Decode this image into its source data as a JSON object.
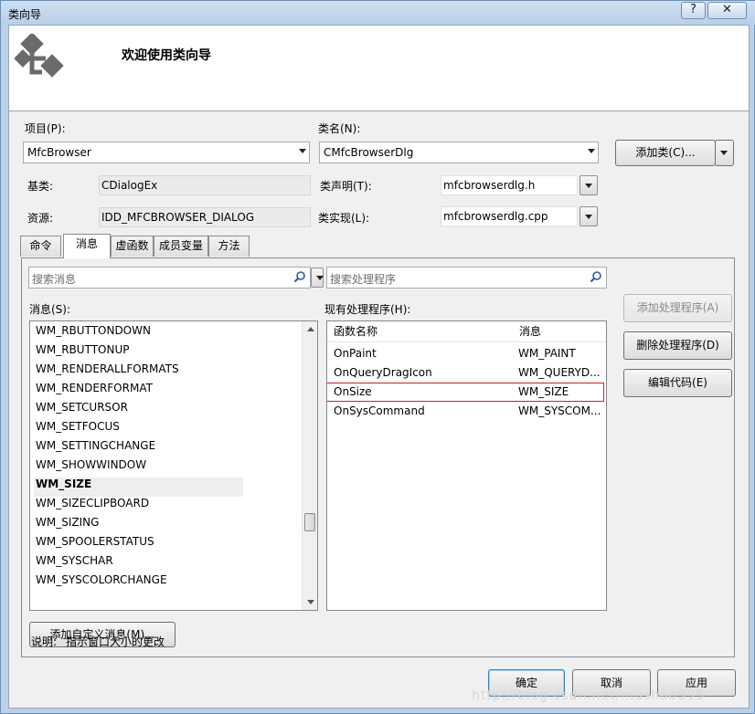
{
  "window": {
    "title": "类向导",
    "help_label": "?",
    "close_label": "✕"
  },
  "header": {
    "title": "欢迎使用类向导"
  },
  "form": {
    "project_label": "项目(P):",
    "project_value": "MfcBrowser",
    "classname_label": "类名(N):",
    "classname_value": "CMfcBrowserDlg",
    "add_class_label": "添加类(C)...",
    "base_label": "基类:",
    "base_value": "CDialogEx",
    "decl_label": "类声明(T):",
    "decl_value": "mfcbrowserdlg.h",
    "resource_label": "资源:",
    "resource_value": "IDD_MFCBROWSER_DIALOG",
    "impl_label": "类实现(L):",
    "impl_value": "mfcbrowserdlg.cpp"
  },
  "tabs": [
    "命令",
    "消息",
    "虚函数",
    "成员变量",
    "方法"
  ],
  "messages": {
    "search_placeholder": "搜索消息",
    "label": "消息(S):",
    "items": [
      "WM_RBUTTONDOWN",
      "WM_RBUTTONUP",
      "WM_RENDERALLFORMATS",
      "WM_RENDERFORMAT",
      "WM_SETCURSOR",
      "WM_SETFOCUS",
      "WM_SETTINGCHANGE",
      "WM_SHOWWINDOW",
      "WM_SIZE",
      "WM_SIZECLIPBOARD",
      "WM_SIZING",
      "WM_SPOOLERSTATUS",
      "WM_SYSCHAR",
      "WM_SYSCOLORCHANGE"
    ],
    "selected": "WM_SIZE",
    "add_custom_label": "添加自定义消息(M)..."
  },
  "handlers": {
    "search_placeholder": "搜索处理程序",
    "label": "现有处理程序(H):",
    "col_func": "函数名称",
    "col_msg": "消息",
    "rows": [
      {
        "func": "OnPaint",
        "msg": "WM_PAINT"
      },
      {
        "func": "OnQueryDragIcon",
        "msg": "WM_QUERYD..."
      },
      {
        "func": "OnSize",
        "msg": "WM_SIZE"
      },
      {
        "func": "OnSysCommand",
        "msg": "WM_SYSCOM..."
      }
    ]
  },
  "actions": {
    "add_handler": "添加处理程序(A)",
    "delete_handler": "删除处理程序(D)",
    "edit_code": "编辑代码(E)"
  },
  "description": {
    "label": "说明:",
    "text": "指示窗口大小的更改"
  },
  "footer": {
    "ok": "确定",
    "cancel": "取消",
    "apply": "应用"
  },
  "watermark": "http://blog.csdn.net/mushao999",
  "colors": {
    "highlight_border": "#d21f24",
    "default_button_border": "#3c7fb1"
  }
}
